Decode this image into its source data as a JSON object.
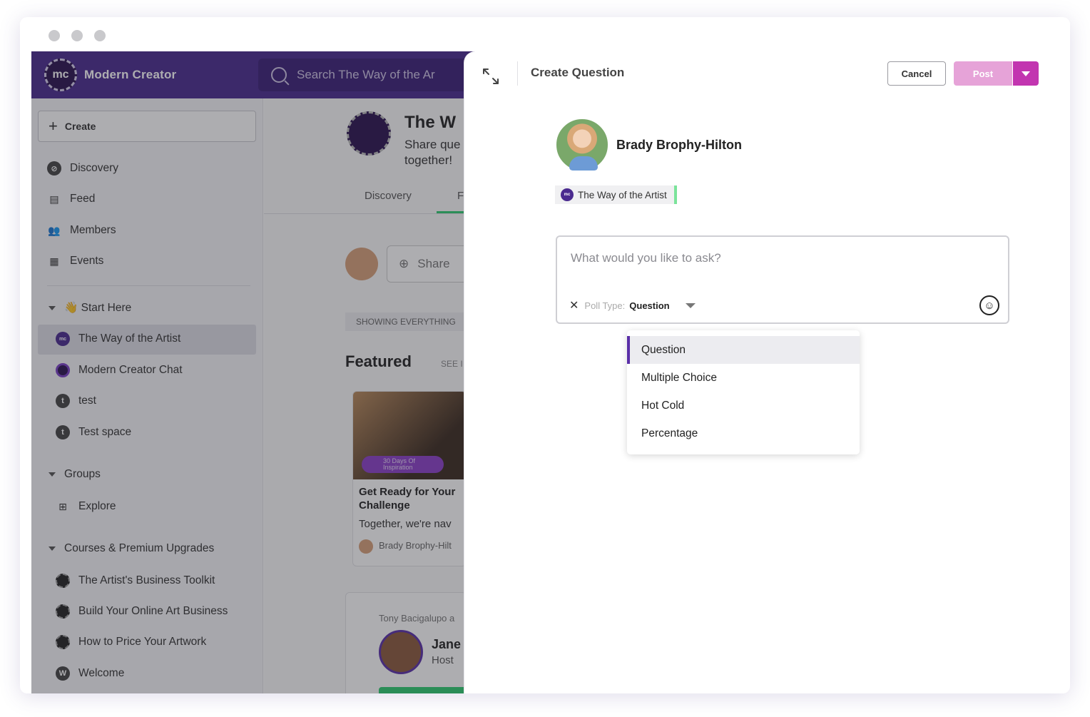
{
  "app": {
    "name": "Modern Creator",
    "logo_text": "mc"
  },
  "search": {
    "placeholder": "Search The Way of the Ar"
  },
  "sidebar": {
    "create_label": "Create",
    "nav": [
      {
        "label": "Discovery",
        "icon": "compass-icon"
      },
      {
        "label": "Feed",
        "icon": "feed-icon"
      },
      {
        "label": "Members",
        "icon": "members-icon"
      },
      {
        "label": "Events",
        "icon": "calendar-icon"
      }
    ],
    "start_here": {
      "title": "👋 Start Here",
      "items": [
        {
          "label": "The Way of the Artist",
          "icon": "mc-logo-icon",
          "active": true
        },
        {
          "label": "Modern Creator Chat",
          "icon": "ring-icon"
        },
        {
          "label": "test",
          "icon": "t",
          "avatar_letter": "t"
        },
        {
          "label": "Test space",
          "icon": "t",
          "avatar_letter": "t"
        }
      ]
    },
    "groups": {
      "title": "Groups",
      "items": [
        {
          "label": "Explore",
          "icon": "grid-icon"
        }
      ]
    },
    "courses": {
      "title": "Courses & Premium Upgrades",
      "items": [
        {
          "label": "The Artist's Business Toolkit"
        },
        {
          "label": "Build Your Online Art Business"
        },
        {
          "label": "How to Price Your Artwork"
        },
        {
          "label": "Welcome",
          "avatar_letter": "W"
        }
      ]
    }
  },
  "main": {
    "title": "The W",
    "subtitle": "Share que together!",
    "tabs": [
      "Discovery",
      "F"
    ],
    "share_placeholder": "Share",
    "showing": "SHOWING EVERYTHING",
    "featured": "Featured",
    "see_all": "SEE I",
    "card": {
      "badge": "30 Days Of Inspiration",
      "title": "Get Ready for Your Challenge",
      "text": "Together, we're nav",
      "author": "Brady Brophy-Hilt"
    },
    "event_card": {
      "line": "Tony Bacigalupo a",
      "name": "Jane",
      "role": "Host"
    }
  },
  "panel": {
    "title": "Create Question",
    "cancel_label": "Cancel",
    "post_label": "Post",
    "user_name": "Brady Brophy-Hilton",
    "space_chip": "The Way of the Artist",
    "chip_logo_text": "mc",
    "question_placeholder": "What would you like to ask?",
    "poll_type_label": "Poll Type:",
    "poll_type_value": "Question",
    "poll_options": [
      "Question",
      "Multiple Choice",
      "Hot Cold",
      "Percentage"
    ],
    "selected_option": "Question"
  },
  "colors": {
    "brand": "#4a2a8f",
    "post_button": "#e6a3d8",
    "post_dropdown": "#c235b0",
    "accent_green": "#7be39a"
  }
}
